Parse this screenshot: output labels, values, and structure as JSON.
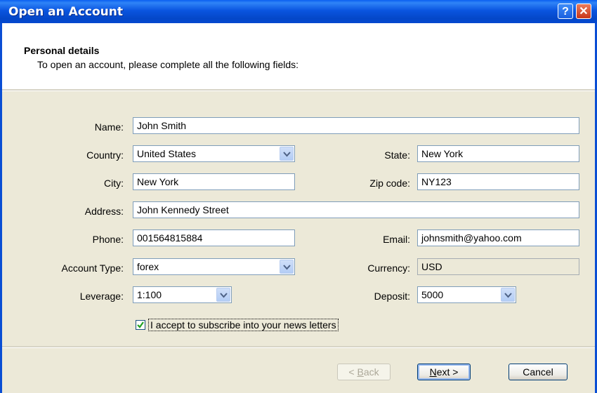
{
  "window": {
    "title": "Open an Account",
    "help_label": "?",
    "close_label": "✕"
  },
  "header": {
    "title": "Personal details",
    "subtitle": "To open an account, please complete all the following fields:"
  },
  "form": {
    "name": {
      "label": "Name:",
      "value": "John Smith"
    },
    "country": {
      "label": "Country:",
      "value": "United States"
    },
    "state": {
      "label": "State:",
      "value": "New York"
    },
    "city": {
      "label": "City:",
      "value": "New York"
    },
    "zip": {
      "label": "Zip code:",
      "value": "NY123"
    },
    "address": {
      "label": "Address:",
      "value": "John Kennedy Street"
    },
    "phone": {
      "label": "Phone:",
      "value": "001564815884"
    },
    "email": {
      "label": "Email:",
      "value": "johnsmith@yahoo.com"
    },
    "account_type": {
      "label": "Account Type:",
      "value": "forex"
    },
    "currency": {
      "label": "Currency:",
      "value": "USD"
    },
    "leverage": {
      "label": "Leverage:",
      "value": "1:100"
    },
    "deposit": {
      "label": "Deposit:",
      "value": "5000"
    },
    "newsletter": {
      "label": "I accept to subscribe into your news letters",
      "checked": true
    }
  },
  "buttons": {
    "back": {
      "prefix": "< ",
      "accel": "B",
      "rest": "ack",
      "enabled": false
    },
    "next": {
      "accel": "N",
      "rest": "ext >"
    },
    "cancel": {
      "label": "Cancel"
    }
  },
  "colors": {
    "titlebar": "#0a55e0",
    "dialog_bg": "#ece9d8",
    "field_border": "#7f9db9"
  },
  "icons": {
    "dropdown": "chevron-down-icon",
    "check": "checkmark-icon"
  }
}
